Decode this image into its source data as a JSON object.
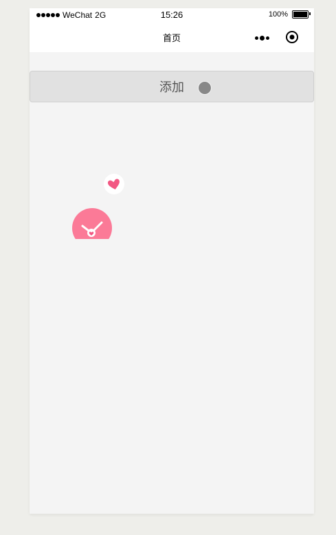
{
  "status_bar": {
    "carrier": "WeChat",
    "network": "2G",
    "time": "15:26",
    "battery_percent": "100%"
  },
  "nav_bar": {
    "title": "首页",
    "more_icon": "more-dots-icon",
    "target_icon": "target-circle-icon"
  },
  "main": {
    "add_button_label": "添加"
  },
  "icons": {
    "heart": "heart-icon",
    "clock": "clock-heart-icon"
  },
  "colors": {
    "page_background": "#f4f4f4",
    "heart_pink": "#f25782",
    "clock_pink": "#fb7a97",
    "button_background": "#e1e1e1"
  }
}
